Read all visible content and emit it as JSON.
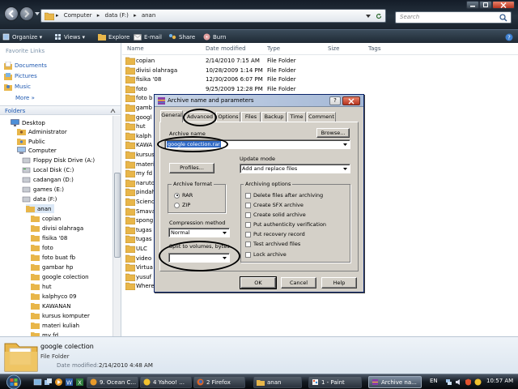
{
  "window": {
    "address_crumbs": [
      "Computer",
      "data (F:)",
      "anan"
    ],
    "search_placeholder": "Search"
  },
  "toolbar": {
    "organize": "Organize",
    "views": "Views",
    "explore": "Explore",
    "email": "E-mail",
    "share": "Share",
    "burn": "Burn"
  },
  "favorites": {
    "heading": "Favorite Links",
    "items": [
      "Documents",
      "Pictures",
      "Music",
      "More"
    ]
  },
  "folders": {
    "label": "Folders",
    "tree": [
      "Desktop",
      "Administrator",
      "Public",
      "Computer",
      "Floppy Disk Drive (A:)",
      "Local Disk (C:)",
      "cadangan (D:)",
      "games (E:)",
      "data (F:)",
      "anan",
      "copian",
      "divisi olahraga",
      "fisika '08",
      "foto",
      "foto buat fb",
      "gambar hp",
      "google colection",
      "hut",
      "kalphyco 09",
      "KAWANAN",
      "kursus komputer",
      "materi kuliah",
      "my fd"
    ]
  },
  "columns": {
    "name": "Name",
    "date": "Date modified",
    "type": "Type",
    "size": "Size",
    "tags": "Tags"
  },
  "files": [
    {
      "name": "copian",
      "date": "2/14/2010 7:15 AM",
      "type": "File Folder"
    },
    {
      "name": "divisi olahraga",
      "date": "10/28/2009 1:14 PM",
      "type": "File Folder"
    },
    {
      "name": "fisika '08",
      "date": "12/30/2006 6:07 PM",
      "type": "File Folder"
    },
    {
      "name": "foto",
      "date": "9/25/2009 12:28 PM",
      "type": "File Folder"
    },
    {
      "name": "foto b",
      "date": "",
      "type": ""
    },
    {
      "name": "gamb",
      "date": "",
      "type": ""
    },
    {
      "name": "googl",
      "date": "",
      "type": ""
    },
    {
      "name": "hut",
      "date": "",
      "type": ""
    },
    {
      "name": "kalph",
      "date": "",
      "type": ""
    },
    {
      "name": "KAWA",
      "date": "",
      "type": ""
    },
    {
      "name": "kursus",
      "date": "",
      "type": ""
    },
    {
      "name": "materi",
      "date": "",
      "type": ""
    },
    {
      "name": "my fd",
      "date": "",
      "type": ""
    },
    {
      "name": "naruto",
      "date": "",
      "type": ""
    },
    {
      "name": "pindah",
      "date": "",
      "type": ""
    },
    {
      "name": "Scienc",
      "date": "",
      "type": ""
    },
    {
      "name": "Smava",
      "date": "",
      "type": ""
    },
    {
      "name": "spong",
      "date": "",
      "type": ""
    },
    {
      "name": "tugas",
      "date": "",
      "type": ""
    },
    {
      "name": "tugas",
      "date": "",
      "type": ""
    },
    {
      "name": "ULC",
      "date": "",
      "type": ""
    },
    {
      "name": "video",
      "date": "",
      "type": ""
    },
    {
      "name": "Virtua",
      "date": "",
      "type": ""
    },
    {
      "name": "yusuf",
      "date": "",
      "type": ""
    },
    {
      "name": "Where",
      "date": "",
      "type": ""
    }
  ],
  "details": {
    "name": "google colection",
    "type": "File Folder",
    "date_label": "Date modified:",
    "date_value": "2/14/2010 4:48 AM"
  },
  "dialog": {
    "title": "Archive name and parameters",
    "help": "?",
    "tabs": [
      "General",
      "Advanced",
      "Options",
      "Files",
      "Backup",
      "Time",
      "Comment"
    ],
    "archive_name_label": "Archive name",
    "archive_name_value": "google colection.rar",
    "browse": "Browse...",
    "update_mode_label": "Update mode",
    "update_mode_value": "Add and replace files",
    "profiles": "Profiles...",
    "archive_format_label": "Archive format",
    "format_rar": "RAR",
    "format_zip": "ZIP",
    "archiving_options_label": "Archiving options",
    "options": [
      "Delete files after archiving",
      "Create SFX archive",
      "Create solid archive",
      "Put authenticity verification",
      "Put recovery record",
      "Test archived files",
      "Lock archive"
    ],
    "compression_label": "Compression method",
    "compression_value": "Normal",
    "split_label": "Split to volumes, bytes",
    "ok": "OK",
    "cancel": "Cancel",
    "help_btn": "Help"
  },
  "taskbar": {
    "tasks": [
      "9. Ocean C...",
      "4 Yahoo! ...",
      "2 Firefox",
      "anan",
      "1 - Paint",
      "Archive na..."
    ],
    "language": "EN",
    "clock": "10:57 AM"
  },
  "colors": {
    "accent": "#1e58b0",
    "folder": "#e8b64a",
    "title_bar": "#1a232d",
    "highlight": "#0a246a"
  },
  "icons": {
    "back": "arrow-left-icon",
    "forward": "arrow-right-icon",
    "search": "search-icon",
    "folder": "folder-icon",
    "start": "windows-start-icon"
  }
}
